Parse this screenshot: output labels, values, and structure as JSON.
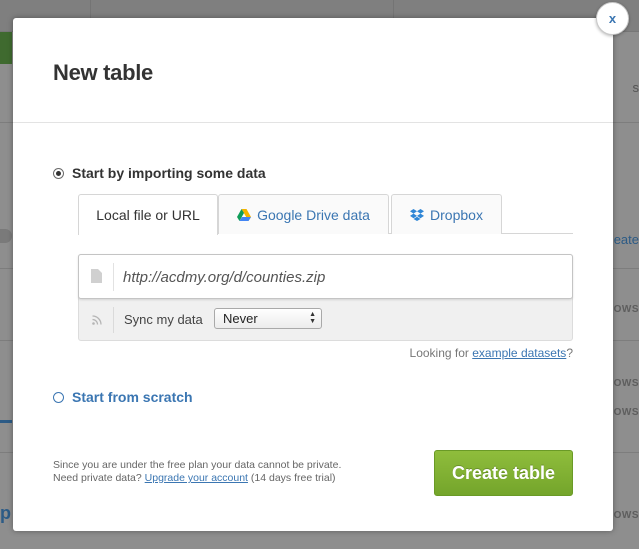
{
  "background": {
    "row_labels": [
      "ROWS",
      "ROWS",
      "ROWS",
      "ROWS"
    ],
    "create_link": "eate",
    "partial_text": "s",
    "partial_char": "p"
  },
  "modal": {
    "title": "New table",
    "close_label": "x",
    "import_option": {
      "label": "Start by importing some data",
      "selected": true
    },
    "tabs": [
      {
        "label": "Local file or URL",
        "icon": "none",
        "active": true
      },
      {
        "label": "Google Drive data",
        "icon": "google-drive-icon",
        "active": false
      },
      {
        "label": "Dropbox",
        "icon": "dropbox-icon",
        "active": false
      }
    ],
    "url_input": {
      "value": "http://acdmy.org/d/counties.zip",
      "placeholder": ""
    },
    "sync": {
      "label": "Sync my data",
      "selected": "Never"
    },
    "examples": {
      "prefix": "Looking for ",
      "link": "example datasets",
      "suffix": "?"
    },
    "scratch_option": {
      "label": "Start from scratch",
      "selected": false
    },
    "footnote": {
      "line1": "Since you are under the free plan your data cannot be private.",
      "line2_prefix": "Need private data? ",
      "line2_link": "Upgrade your account",
      "line2_suffix": " (14 days free trial)"
    },
    "create_button": "Create table"
  },
  "colors": {
    "accent_blue": "#3b76b2",
    "button_green": "#7fae31",
    "overlay_gray": "#8e8e8e"
  }
}
